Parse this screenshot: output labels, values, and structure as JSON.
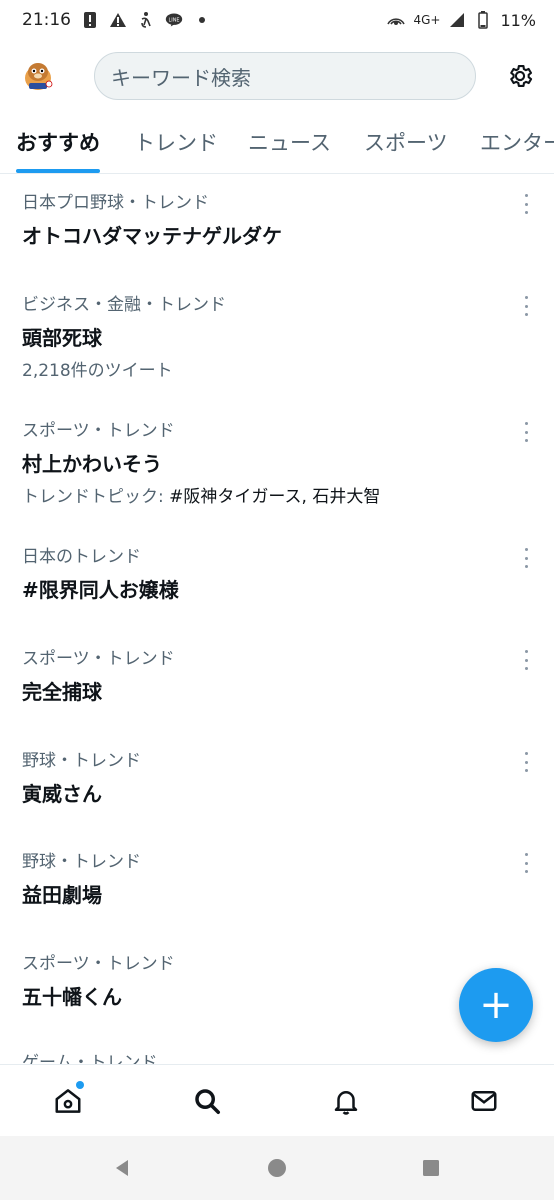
{
  "status_bar": {
    "time": "21:16",
    "network": "4G+",
    "battery": "11%",
    "notification_icons": [
      "sim-alert-icon",
      "warning-icon",
      "accessibility-icon",
      "line-icon",
      "more-dot-icon"
    ]
  },
  "header": {
    "avatar_icon": "profile-avatar-icon",
    "search_placeholder": "キーワード検索",
    "settings_icon": "gear-icon"
  },
  "tabs": [
    {
      "label": "おすすめ",
      "active": true
    },
    {
      "label": "トレンド",
      "active": false
    },
    {
      "label": "ニュース",
      "active": false
    },
    {
      "label": "スポーツ",
      "active": false
    },
    {
      "label": "エンター",
      "active": false
    }
  ],
  "trends": [
    {
      "category": "日本プロ野球・トレンド",
      "title": "オトコハダマッテナゲルダケ"
    },
    {
      "category": "ビジネス・金融・トレンド",
      "title": "頭部死球",
      "meta": "2,218件のツイート"
    },
    {
      "category": "スポーツ・トレンド",
      "title": "村上かわいそう",
      "meta_prefix": "トレンドトピック: ",
      "meta_topics": "#阪神タイガース, 石井大智"
    },
    {
      "category": "日本のトレンド",
      "title": "#限界同人お嬢様"
    },
    {
      "category": "スポーツ・トレンド",
      "title": "完全捕球"
    },
    {
      "category": "野球・トレンド",
      "title": "寅威さん"
    },
    {
      "category": "野球・トレンド",
      "title": "益田劇場"
    },
    {
      "category": "スポーツ・トレンド",
      "title": "五十幡くん"
    }
  ],
  "partial_trend_category": "ゲーム・トレンド",
  "fab": {
    "icon": "plus-icon",
    "label": "+"
  },
  "bottom_nav": [
    "home-icon",
    "search-icon",
    "notifications-icon",
    "messages-icon"
  ],
  "accent_color": "#1d9bf0"
}
